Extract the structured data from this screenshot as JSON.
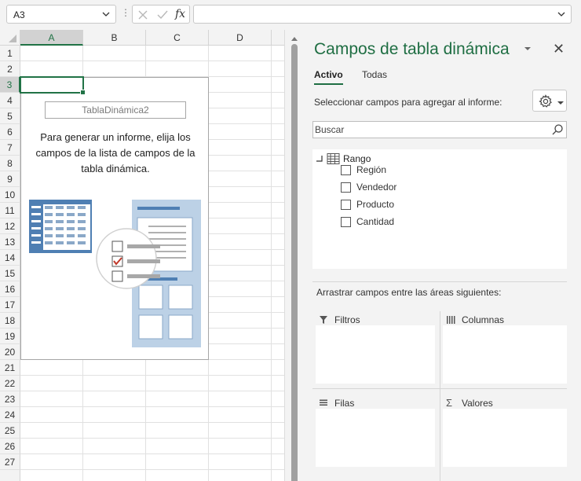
{
  "formula_bar": {
    "name_box": "A3",
    "fx_label": "fx",
    "formula": ""
  },
  "sheet": {
    "columns": [
      "A",
      "B",
      "C",
      "D"
    ],
    "rows": [
      "1",
      "2",
      "3",
      "4",
      "5",
      "6",
      "7",
      "8",
      "9",
      "10",
      "11",
      "12",
      "13",
      "14",
      "15",
      "16",
      "17",
      "18",
      "19",
      "20",
      "21",
      "22",
      "23",
      "24",
      "25",
      "26",
      "27"
    ],
    "selected_column": "A",
    "selected_row": "3"
  },
  "pivot_placeholder": {
    "name": "TablaDinámica2",
    "instructions": "Para generar un informe, elija los campos de la lista de campos de la tabla dinámica."
  },
  "pane": {
    "title": "Campos de tabla dinámica",
    "tabs": [
      "Activo",
      "Todas"
    ],
    "choose_label": "Seleccionar campos para agregar al informe:",
    "search_placeholder": "Buscar",
    "range_label": "Rango",
    "fields": [
      {
        "label": "Región",
        "checked": false
      },
      {
        "label": "Vendedor",
        "checked": false
      },
      {
        "label": "Producto",
        "checked": false
      },
      {
        "label": "Cantidad",
        "checked": false
      }
    ],
    "drag_label": "Arrastrar campos entre las áreas siguientes:",
    "areas": {
      "filters": "Filtros",
      "columns": "Columnas",
      "rows": "Filas",
      "values": "Valores"
    }
  },
  "colors": {
    "accent": "#217346",
    "pane_title": "#1f6e43",
    "illustration_blue": "#4f7fb3",
    "illustration_light": "#bcd1e6",
    "check_red": "#c0392b"
  }
}
